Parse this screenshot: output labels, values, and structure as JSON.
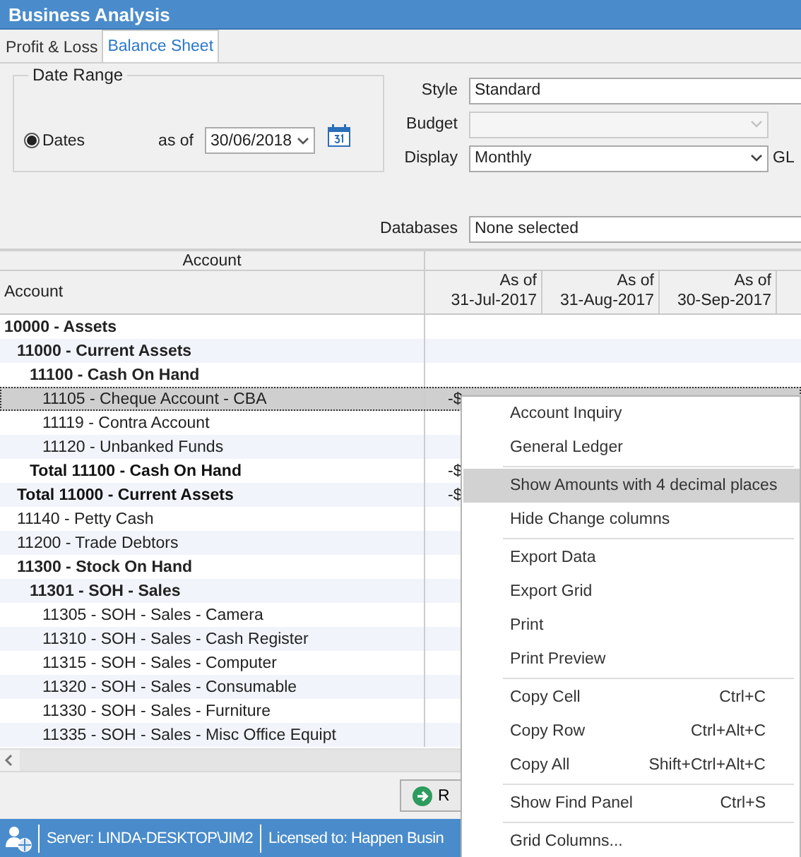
{
  "window": {
    "title": "Business Analysis"
  },
  "tabs": [
    {
      "label": "Profit & Loss",
      "selected": false
    },
    {
      "label": "Balance Sheet",
      "selected": true
    }
  ],
  "date_range": {
    "title": "Date Range",
    "option": {
      "label": "Dates",
      "selected": true
    },
    "as_of_label": "as of",
    "date": "30/06/2018"
  },
  "style": {
    "label": "Style",
    "value": "Standard"
  },
  "budget": {
    "label": "Budget",
    "disabled": true
  },
  "display": {
    "label": "Display",
    "value": "Monthly",
    "side_label": "GL"
  },
  "databases": {
    "label": "Databases",
    "value": "None selected"
  },
  "grid": {
    "band": "Account",
    "columns": [
      {
        "title": "Account"
      },
      {
        "line1": "As of",
        "line2": "31-Jul-2017"
      },
      {
        "line1": "As of",
        "line2": "31-Aug-2017"
      },
      {
        "line1": "As of",
        "line2": "30-Sep-2017"
      }
    ],
    "rows": [
      {
        "text": "10000 - Assets",
        "kind": "group",
        "selected": false,
        "children": [
          {
            "text": "11000 - Current Assets",
            "kind": "group",
            "selected": false,
            "children": [
              {
                "text": "11100 - Cash On Hand",
                "kind": "group",
                "selected": false,
                "children": [
                  {
                    "text": "11105 - Cheque Account - CBA",
                    "kind": "account",
                    "selected": true,
                    "amount": "-$"
                  },
                  {
                    "text": "11119 - Contra Account",
                    "kind": "account",
                    "selected": false
                  },
                  {
                    "text": "11120 - Unbanked Funds",
                    "kind": "account",
                    "selected": false
                  }
                ]
              },
              {
                "text": "Total 11100 - Cash On Hand",
                "kind": "total",
                "selected": false,
                "amount": "-$"
              }
            ]
          },
          {
            "text": "Total 11000 - Current Assets",
            "kind": "total",
            "selected": false,
            "amount": "-$"
          },
          {
            "text": "11140 - Petty Cash",
            "kind": "account",
            "selected": false
          },
          {
            "text": "11200 - Trade Debtors",
            "kind": "account",
            "selected": false
          },
          {
            "text": "11300 - Stock On Hand",
            "kind": "group",
            "selected": false,
            "children": [
              {
                "text": "11301 - SOH - Sales",
                "kind": "group",
                "selected": false,
                "children": [
                  {
                    "text": "11305 - SOH - Sales - Camera",
                    "kind": "account",
                    "selected": false
                  },
                  {
                    "text": "11310 - SOH - Sales - Cash Register",
                    "kind": "account",
                    "selected": false
                  },
                  {
                    "text": "11315 - SOH - Sales - Computer",
                    "kind": "account",
                    "selected": false
                  },
                  {
                    "text": "11320 - SOH - Sales - Consumable",
                    "kind": "account",
                    "selected": false
                  },
                  {
                    "text": "11330 - SOH - Sales - Furniture",
                    "kind": "account",
                    "selected": false
                  },
                  {
                    "text": "11335 - SOH - Sales - Misc Office Equipt",
                    "kind": "account",
                    "selected": false
                  }
                ]
              }
            ]
          }
        ]
      }
    ]
  },
  "run_button": {
    "label": "R"
  },
  "status_bar": {
    "server": "Server: LINDA-DESKTOP\\JIM2",
    "license": "Licensed to: Happen Busin"
  },
  "context_menu": {
    "groups": [
      [
        {
          "label": "Account Inquiry",
          "selected": false
        },
        {
          "label": "General Ledger",
          "selected": false
        }
      ],
      [
        {
          "label": "Show Amounts with 4 decimal places",
          "selected": true
        },
        {
          "label": "Hide Change columns",
          "selected": false
        }
      ],
      [
        {
          "label": "Export Data",
          "selected": false
        },
        {
          "label": "Export Grid",
          "selected": false
        },
        {
          "label": "Print",
          "selected": false
        },
        {
          "label": "Print Preview",
          "selected": false
        }
      ],
      [
        {
          "label": "Copy Cell",
          "shortcut": "Ctrl+C",
          "selected": false
        },
        {
          "label": "Copy Row",
          "shortcut": "Ctrl+Alt+C",
          "selected": false
        },
        {
          "label": "Copy All",
          "shortcut": "Shift+Ctrl+Alt+C",
          "selected": false
        }
      ],
      [
        {
          "label": "Show Find Panel",
          "shortcut": "Ctrl+S",
          "selected": false
        }
      ],
      [
        {
          "label": "Grid Columns...",
          "selected": false
        }
      ]
    ]
  }
}
